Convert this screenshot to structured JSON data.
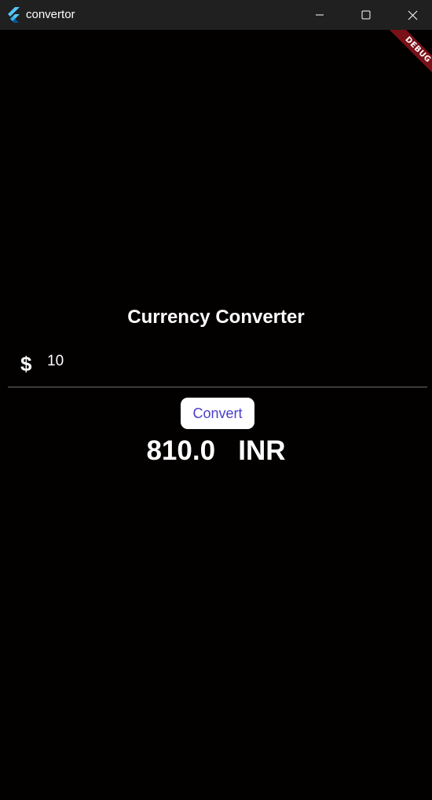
{
  "window": {
    "title": "convertor",
    "app_icon": "flutter-logo-icon",
    "controls": {
      "minimize_icon": "minimize-icon",
      "maximize_icon": "maximize-icon",
      "close_icon": "close-icon"
    }
  },
  "debug_banner": {
    "label": "DEBUG",
    "color": "#7a1118"
  },
  "converter": {
    "heading": "Currency Converter",
    "currency_symbol": "$",
    "amount_value": "10",
    "convert_label": "Convert",
    "result_value": "810.0",
    "result_currency": "INR"
  },
  "colors": {
    "background": "#030000",
    "titlebar": "#202020",
    "button_text": "#4a3ec8",
    "underline": "#6e6e6e"
  }
}
